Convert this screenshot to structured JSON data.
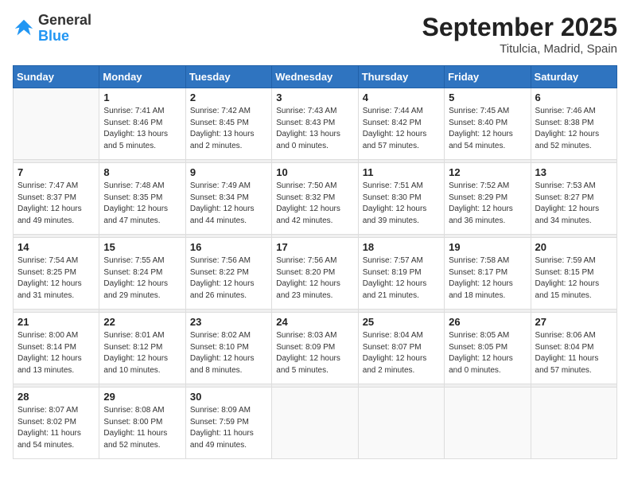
{
  "header": {
    "logo_general": "General",
    "logo_blue": "Blue",
    "title": "September 2025",
    "subtitle": "Titulcia, Madrid, Spain"
  },
  "weekdays": [
    "Sunday",
    "Monday",
    "Tuesday",
    "Wednesday",
    "Thursday",
    "Friday",
    "Saturday"
  ],
  "weeks": [
    [
      {
        "day": null
      },
      {
        "day": "1",
        "sunrise": "7:41 AM",
        "sunset": "8:46 PM",
        "daylight": "13 hours and 5 minutes."
      },
      {
        "day": "2",
        "sunrise": "7:42 AM",
        "sunset": "8:45 PM",
        "daylight": "13 hours and 2 minutes."
      },
      {
        "day": "3",
        "sunrise": "7:43 AM",
        "sunset": "8:43 PM",
        "daylight": "13 hours and 0 minutes."
      },
      {
        "day": "4",
        "sunrise": "7:44 AM",
        "sunset": "8:42 PM",
        "daylight": "12 hours and 57 minutes."
      },
      {
        "day": "5",
        "sunrise": "7:45 AM",
        "sunset": "8:40 PM",
        "daylight": "12 hours and 54 minutes."
      },
      {
        "day": "6",
        "sunrise": "7:46 AM",
        "sunset": "8:38 PM",
        "daylight": "12 hours and 52 minutes."
      }
    ],
    [
      {
        "day": "7",
        "sunrise": "7:47 AM",
        "sunset": "8:37 PM",
        "daylight": "12 hours and 49 minutes."
      },
      {
        "day": "8",
        "sunrise": "7:48 AM",
        "sunset": "8:35 PM",
        "daylight": "12 hours and 47 minutes."
      },
      {
        "day": "9",
        "sunrise": "7:49 AM",
        "sunset": "8:34 PM",
        "daylight": "12 hours and 44 minutes."
      },
      {
        "day": "10",
        "sunrise": "7:50 AM",
        "sunset": "8:32 PM",
        "daylight": "12 hours and 42 minutes."
      },
      {
        "day": "11",
        "sunrise": "7:51 AM",
        "sunset": "8:30 PM",
        "daylight": "12 hours and 39 minutes."
      },
      {
        "day": "12",
        "sunrise": "7:52 AM",
        "sunset": "8:29 PM",
        "daylight": "12 hours and 36 minutes."
      },
      {
        "day": "13",
        "sunrise": "7:53 AM",
        "sunset": "8:27 PM",
        "daylight": "12 hours and 34 minutes."
      }
    ],
    [
      {
        "day": "14",
        "sunrise": "7:54 AM",
        "sunset": "8:25 PM",
        "daylight": "12 hours and 31 minutes."
      },
      {
        "day": "15",
        "sunrise": "7:55 AM",
        "sunset": "8:24 PM",
        "daylight": "12 hours and 29 minutes."
      },
      {
        "day": "16",
        "sunrise": "7:56 AM",
        "sunset": "8:22 PM",
        "daylight": "12 hours and 26 minutes."
      },
      {
        "day": "17",
        "sunrise": "7:56 AM",
        "sunset": "8:20 PM",
        "daylight": "12 hours and 23 minutes."
      },
      {
        "day": "18",
        "sunrise": "7:57 AM",
        "sunset": "8:19 PM",
        "daylight": "12 hours and 21 minutes."
      },
      {
        "day": "19",
        "sunrise": "7:58 AM",
        "sunset": "8:17 PM",
        "daylight": "12 hours and 18 minutes."
      },
      {
        "day": "20",
        "sunrise": "7:59 AM",
        "sunset": "8:15 PM",
        "daylight": "12 hours and 15 minutes."
      }
    ],
    [
      {
        "day": "21",
        "sunrise": "8:00 AM",
        "sunset": "8:14 PM",
        "daylight": "12 hours and 13 minutes."
      },
      {
        "day": "22",
        "sunrise": "8:01 AM",
        "sunset": "8:12 PM",
        "daylight": "12 hours and 10 minutes."
      },
      {
        "day": "23",
        "sunrise": "8:02 AM",
        "sunset": "8:10 PM",
        "daylight": "12 hours and 8 minutes."
      },
      {
        "day": "24",
        "sunrise": "8:03 AM",
        "sunset": "8:09 PM",
        "daylight": "12 hours and 5 minutes."
      },
      {
        "day": "25",
        "sunrise": "8:04 AM",
        "sunset": "8:07 PM",
        "daylight": "12 hours and 2 minutes."
      },
      {
        "day": "26",
        "sunrise": "8:05 AM",
        "sunset": "8:05 PM",
        "daylight": "12 hours and 0 minutes."
      },
      {
        "day": "27",
        "sunrise": "8:06 AM",
        "sunset": "8:04 PM",
        "daylight": "11 hours and 57 minutes."
      }
    ],
    [
      {
        "day": "28",
        "sunrise": "8:07 AM",
        "sunset": "8:02 PM",
        "daylight": "11 hours and 54 minutes."
      },
      {
        "day": "29",
        "sunrise": "8:08 AM",
        "sunset": "8:00 PM",
        "daylight": "11 hours and 52 minutes."
      },
      {
        "day": "30",
        "sunrise": "8:09 AM",
        "sunset": "7:59 PM",
        "daylight": "11 hours and 49 minutes."
      },
      {
        "day": null
      },
      {
        "day": null
      },
      {
        "day": null
      },
      {
        "day": null
      }
    ]
  ],
  "labels": {
    "sunrise": "Sunrise:",
    "sunset": "Sunset:",
    "daylight": "Daylight:"
  }
}
